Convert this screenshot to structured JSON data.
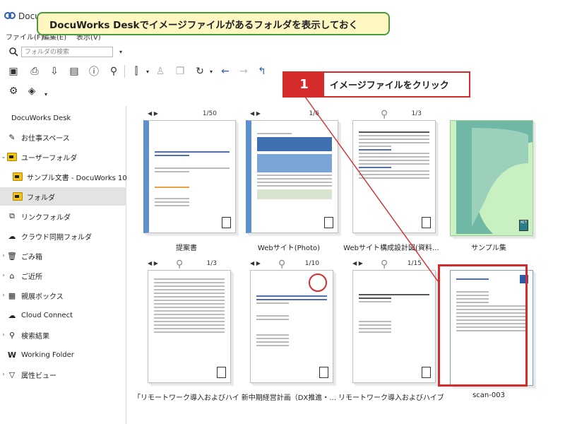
{
  "app": {
    "title": "DocuWorks"
  },
  "menu": [
    "ファイル(F)",
    "編集(E)",
    "表示(V)"
  ],
  "callouts": {
    "title": "DocuWorks Deskでイメージファイルがあるフォルダを表示しておく",
    "step_number": "1",
    "step_text": "イメージファイルをクリック"
  },
  "toolbar": {
    "search_placeholder": "フォルダの検索"
  },
  "sidebar": {
    "header": "DocuWorks Desk",
    "items": [
      {
        "label": "お仕事スペース",
        "icon": "pen-icon"
      },
      {
        "label": "ユーザーフォルダ",
        "icon": "folder-icon"
      },
      {
        "label": "サンプル文書 - DocuWorks 10",
        "icon": "folder-icon"
      },
      {
        "label": "フォルダ",
        "icon": "folder-icon"
      },
      {
        "label": "リンクフォルダ",
        "icon": "link-folder-icon"
      },
      {
        "label": "クラウド同期フォルダ",
        "icon": "cloud-icon"
      },
      {
        "label": "ごみ箱",
        "icon": "trash-icon"
      },
      {
        "label": "ご近所",
        "icon": "neighborhood-icon"
      },
      {
        "label": "親展ボックス",
        "icon": "mailbox-icon"
      },
      {
        "label": "Cloud Connect",
        "icon": "cloud-connect-icon"
      },
      {
        "label": "検索結果",
        "icon": "search-icon"
      },
      {
        "label": "Working Folder",
        "icon": "working-folder-icon"
      },
      {
        "label": "属性ビュー",
        "icon": "filter-icon"
      }
    ]
  },
  "documents": [
    {
      "name": "提案書",
      "pages": "1/50",
      "style": "blue"
    },
    {
      "name": "Webサイト(Photo)",
      "pages": "1/6",
      "style": "blue"
    },
    {
      "name": "Webサイト構成設計図(資料…",
      "pages": "1/3",
      "style": "plain"
    },
    {
      "name": "サンプル集",
      "pages": "",
      "style": "green"
    },
    {
      "name": "「リモートワーク導入およびハイ…",
      "pages": "1/3",
      "style": "plain"
    },
    {
      "name": "新中期経営計画（DX推進・…",
      "pages": "1/10",
      "style": "plain"
    },
    {
      "name": "リモートワーク導入およびハイブ…",
      "pages": "1/15",
      "style": "plain"
    },
    {
      "name": "scan-003",
      "pages": "",
      "style": "scan"
    }
  ],
  "colors": {
    "accent_red": "#d62b2b",
    "callout_green": "#4b9a3c",
    "callout_bg": "#fff7c2"
  }
}
